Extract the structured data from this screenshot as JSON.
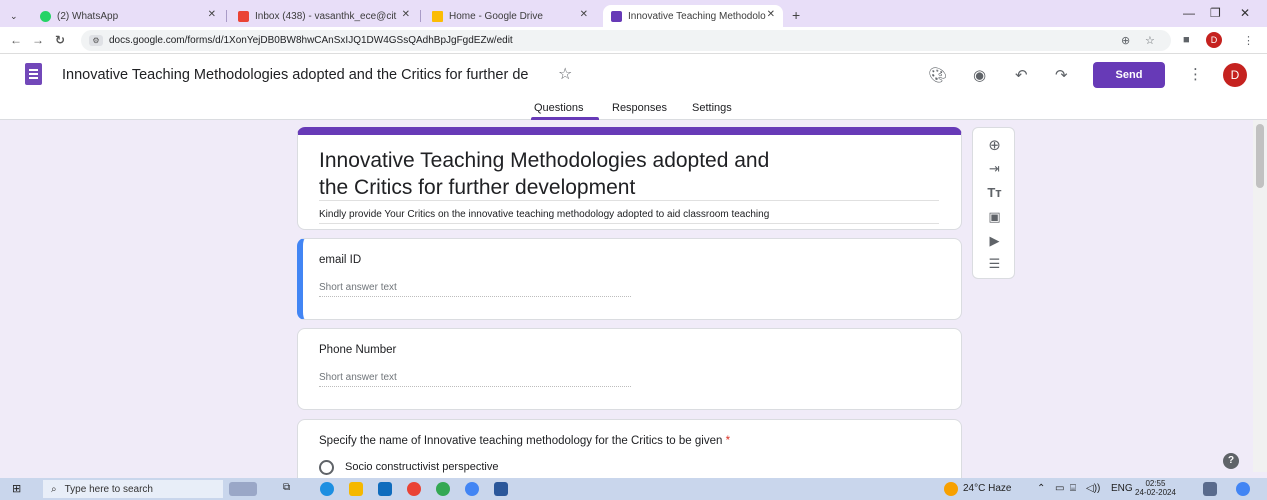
{
  "browser": {
    "tabs": [
      {
        "title": "(2) WhatsApp",
        "favicon_color": "#25d366"
      },
      {
        "title": "Inbox (438) - vasanthk_ece@cit",
        "favicon_color": "#ea4335"
      },
      {
        "title": "Home - Google Drive",
        "favicon_color": "#fbbc04"
      },
      {
        "title": "Innovative Teaching Methodolo",
        "favicon_color": "#673ab7"
      }
    ],
    "close_glyph": "✕",
    "new_tab": "+",
    "url": "docs.google.com/forms/d/1XonYejDB0BW8hwCAnSxIJQ1DW4GSsQAdhBpJgFgdEZw/edit",
    "profile_initial": "D"
  },
  "form_header": {
    "doc_title": "Innovative Teaching Methodologies adopted and the Critics for further de",
    "send_label": "Send",
    "avatar_initial": "D",
    "tabs": [
      "Questions",
      "Responses",
      "Settings"
    ],
    "active_tab": "Questions"
  },
  "form": {
    "title_line1": "Innovative Teaching Methodologies adopted and",
    "title_line2": "the Critics for further development",
    "description": "Kindly provide Your Critics on the innovative teaching methodology adopted to aid classroom teaching",
    "questions": [
      {
        "label": "email ID",
        "hint": "Short answer text"
      },
      {
        "label": "Phone Number",
        "hint": "Short answer text"
      },
      {
        "label": "Specify the name of Innovative teaching methodology for the Critics to be given",
        "required_mark": "*",
        "option": "Socio constructivist perspective"
      }
    ]
  },
  "toolbar_icons": [
    "add-question-icon",
    "import-questions-icon",
    "add-title-icon",
    "add-image-icon",
    "add-video-icon",
    "add-section-icon"
  ],
  "taskbar": {
    "search_placeholder": "Type here to search",
    "weather": "24°C  Haze",
    "language": "ENG",
    "time": "02:55",
    "date": "24-02-2024"
  },
  "colors": {
    "accent": "#673ab7",
    "selected": "#4285f4",
    "background": "#f0ebf8"
  }
}
